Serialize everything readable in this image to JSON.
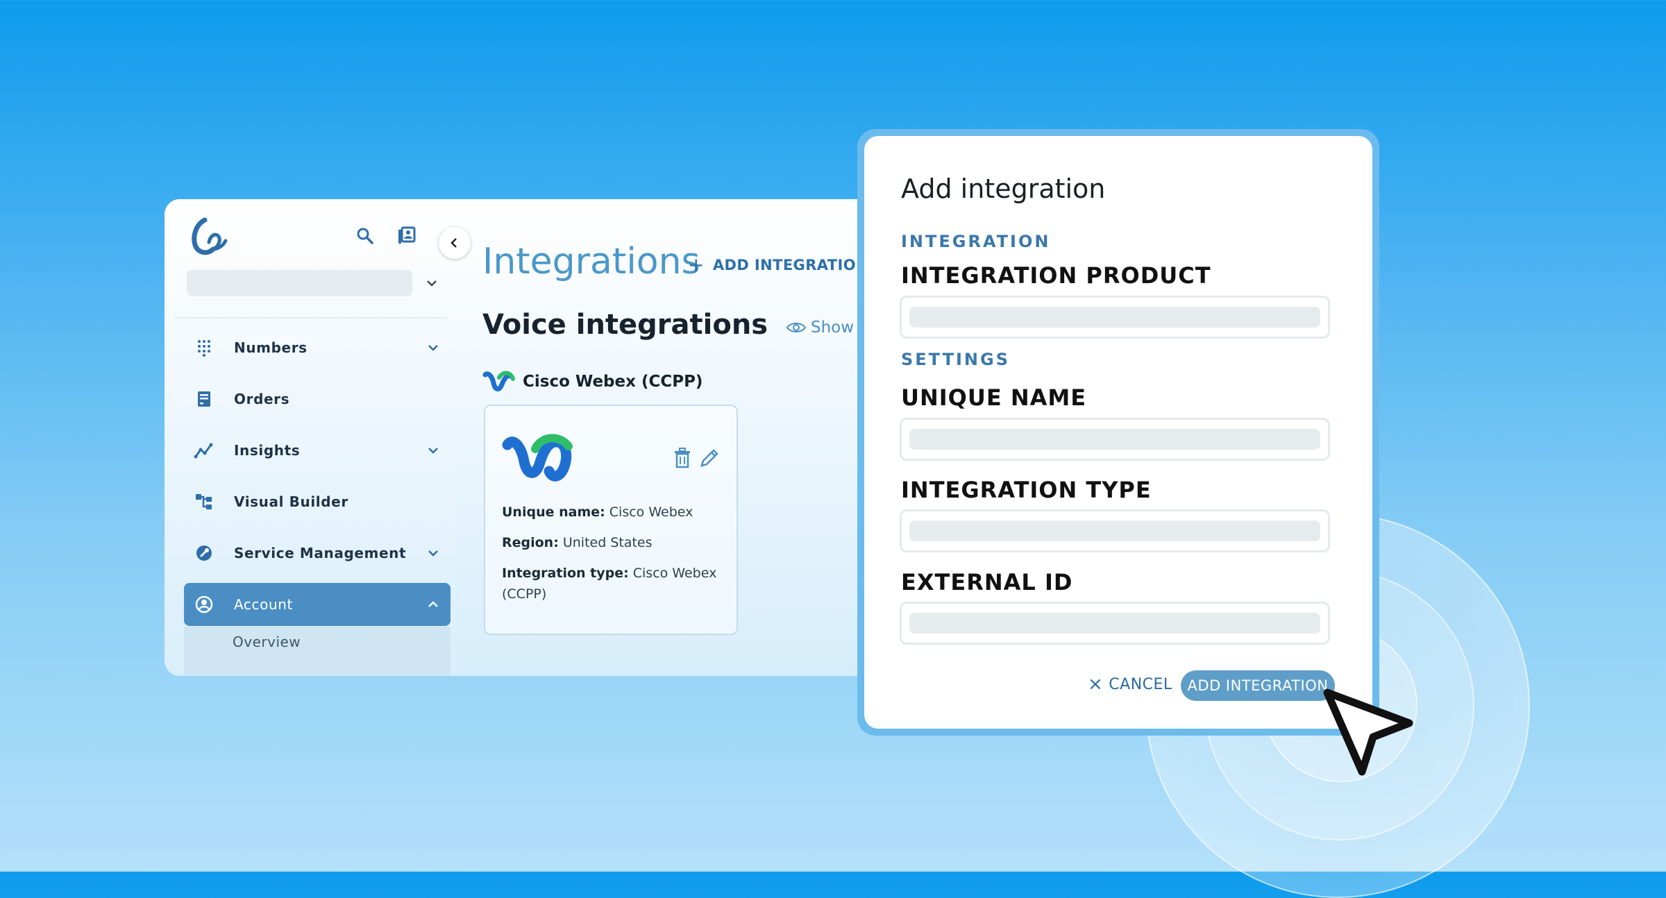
{
  "sidebar": {
    "nav": [
      {
        "label": "Numbers",
        "icon": "dialpad-icon",
        "chevron": true
      },
      {
        "label": "Orders",
        "icon": "receipt-icon",
        "chevron": false
      },
      {
        "label": "Insights",
        "icon": "insights-icon",
        "chevron": true
      },
      {
        "label": "Visual Builder",
        "icon": "flow-icon",
        "chevron": false
      },
      {
        "label": "Service Management",
        "icon": "service-icon",
        "chevron": true
      },
      {
        "label": "Account",
        "icon": "account-icon",
        "chevron": true,
        "active": true
      }
    ],
    "sub_item": "Overview"
  },
  "main": {
    "title": "Integrations",
    "add_link": "ADD INTEGRATION",
    "section_title": "Voice integrations",
    "show_all": "Show All",
    "provider": "Cisco Webex (CCPP)",
    "card": {
      "unique_name_label": "Unique name:",
      "unique_name": "Cisco Webex",
      "region_label": "Region:",
      "region": "United States",
      "type_label": "Integration type:",
      "type": "Cisco Webex (CCPP)"
    }
  },
  "modal": {
    "title": "Add integration",
    "section_integration": "INTEGRATION",
    "label_product": "INTEGRATION PRODUCT",
    "section_settings": "SETTINGS",
    "label_unique_name": "UNIQUE NAME",
    "label_type": "INTEGRATION TYPE",
    "label_external_id": "EXTERNAL ID",
    "cancel": "CANCEL",
    "submit": "ADD INTEGRATION"
  },
  "colors": {
    "accent": "#4a8ec4",
    "title_blue": "#4a98c9",
    "modal_border": "#6cbbed"
  }
}
